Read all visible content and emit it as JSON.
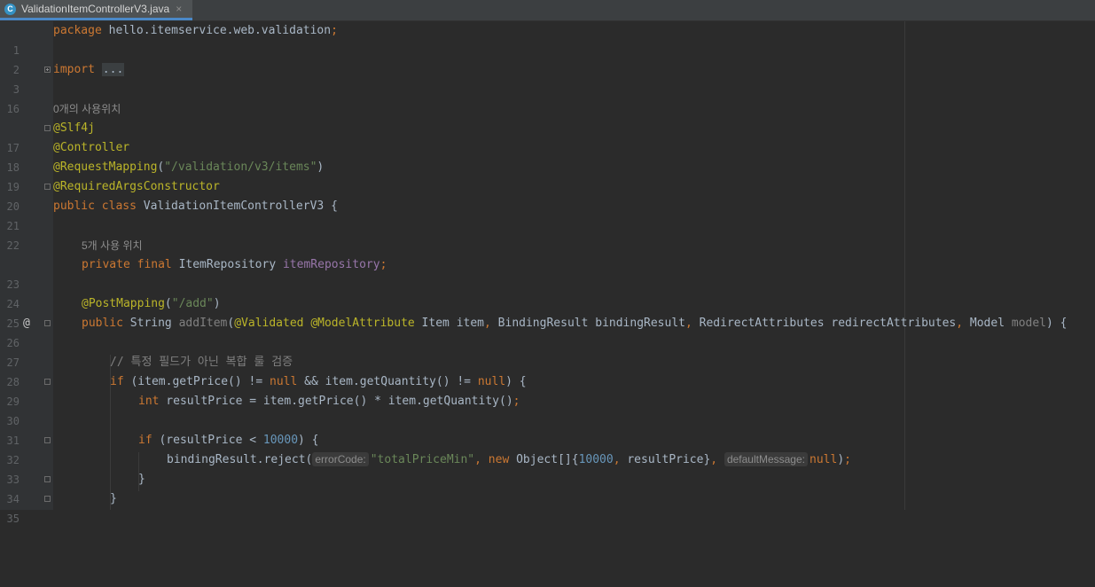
{
  "tab": {
    "icon_letter": "C",
    "filename": "ValidationItemControllerV3.java",
    "close": "×"
  },
  "lines": {
    "l1": {
      "num": "1",
      "kw": "package",
      "rest": " hello.itemservice.web.validation",
      "semi": ";"
    },
    "l2": {
      "num": "2"
    },
    "l3": {
      "num": "3",
      "kw": "import",
      "folded": "..."
    },
    "l16": {
      "num": "16"
    },
    "usage1": "0개의 사용위치",
    "l17": {
      "num": "17",
      "an": "@Slf4j"
    },
    "l18": {
      "num": "18",
      "an": "@Controller"
    },
    "l19": {
      "num": "19",
      "an": "@RequestMapping",
      "p1": "(",
      "str": "\"/validation/v3/items\"",
      "p2": ")"
    },
    "l20": {
      "num": "20",
      "an": "@RequiredArgsConstructor"
    },
    "l21": {
      "num": "21",
      "kw": "public class",
      "rest": " ValidationItemControllerV3 {"
    },
    "l22": {
      "num": "22"
    },
    "usage2": "5개 사용 위치",
    "l23": {
      "num": "23",
      "kw": "private final",
      "type": " ItemRepository ",
      "fld": "itemRepository",
      "semi": ";"
    },
    "l24": {
      "num": "24"
    },
    "l25": {
      "num": "25",
      "an": "@PostMapping",
      "p1": "(",
      "str": "\"/add\"",
      "p2": ")"
    },
    "l26": {
      "num": "26",
      "gutter_icon": "@",
      "kw": "public",
      "type": " String ",
      "method": "addItem",
      "p1": "(",
      "an1": "@Validated",
      "sp1": " ",
      "an2": "@ModelAttribute",
      "rest1": " Item item",
      "comma1": ", ",
      "rest2": "BindingResult bindingResult",
      "comma2": ", ",
      "rest3": "RedirectAttributes redirectAttributes",
      "comma3": ", ",
      "rest4": "Model ",
      "param": "model",
      "end": ") {"
    },
    "l27": {
      "num": "27"
    },
    "l28": {
      "num": "28",
      "comment": "// 특정 필드가 아닌 복합 룰 검증"
    },
    "l29": {
      "num": "29",
      "kw1": "if",
      "r1": " (item.getPrice() != ",
      "kw2": "null",
      "r2": " && item.getQuantity() != ",
      "kw3": "null",
      "r3": ") {"
    },
    "l30": {
      "num": "30",
      "kw": "int",
      "rest": " resultPrice = item.getPrice() * item.getQuantity()",
      "semi": ";"
    },
    "l31": {
      "num": "31"
    },
    "l32": {
      "num": "32",
      "kw": "if",
      "r1": " (resultPrice < ",
      "numv": "10000",
      "r2": ") {"
    },
    "l33": {
      "num": "33",
      "r1": "bindingResult.reject(",
      "hint1": "errorCode:",
      "str": "\"totalPriceMin\"",
      "comma1": ", ",
      "kw": "new",
      "r2": " Object[]{",
      "numv": "10000",
      "comma2": ", ",
      "r3": "resultPrice}",
      "comma3": ", ",
      "hint2": "defaultMessage:",
      "kw2": "null",
      "r4": ")",
      "semi": ";"
    },
    "l34": {
      "num": "34",
      "rest": "}"
    },
    "l35": {
      "num": "35",
      "rest": "}"
    }
  },
  "colors": {
    "background": "#2b2b2b",
    "keyword": "#cc7832",
    "annotation": "#bbb529",
    "string": "#6a8759",
    "number": "#6897bb",
    "field": "#9876aa"
  }
}
